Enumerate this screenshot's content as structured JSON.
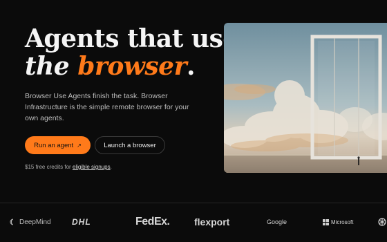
{
  "hero": {
    "title_line1": "Agents that use",
    "title_the": "the ",
    "title_accent": "browser",
    "title_period": ".",
    "description": "Browser Use Agents finish the task. Browser Infrastructure is the simple remote browser for your own agents.",
    "primary_button": "Run an agent",
    "primary_button_arrow": "↗",
    "secondary_button": "Launch a browser",
    "credits_prefix": "$15 free credits for ",
    "credits_link": "eligible signups",
    "credits_suffix": "."
  },
  "logos": {
    "deepmind": "DeepMind",
    "dhl": "DHL",
    "fedex": "FedEx.",
    "flexport": "flexport",
    "google": "Google",
    "microsoft": "Microsoft"
  },
  "colors": {
    "accent": "#ff7a1a",
    "background": "#0b0b0b"
  }
}
